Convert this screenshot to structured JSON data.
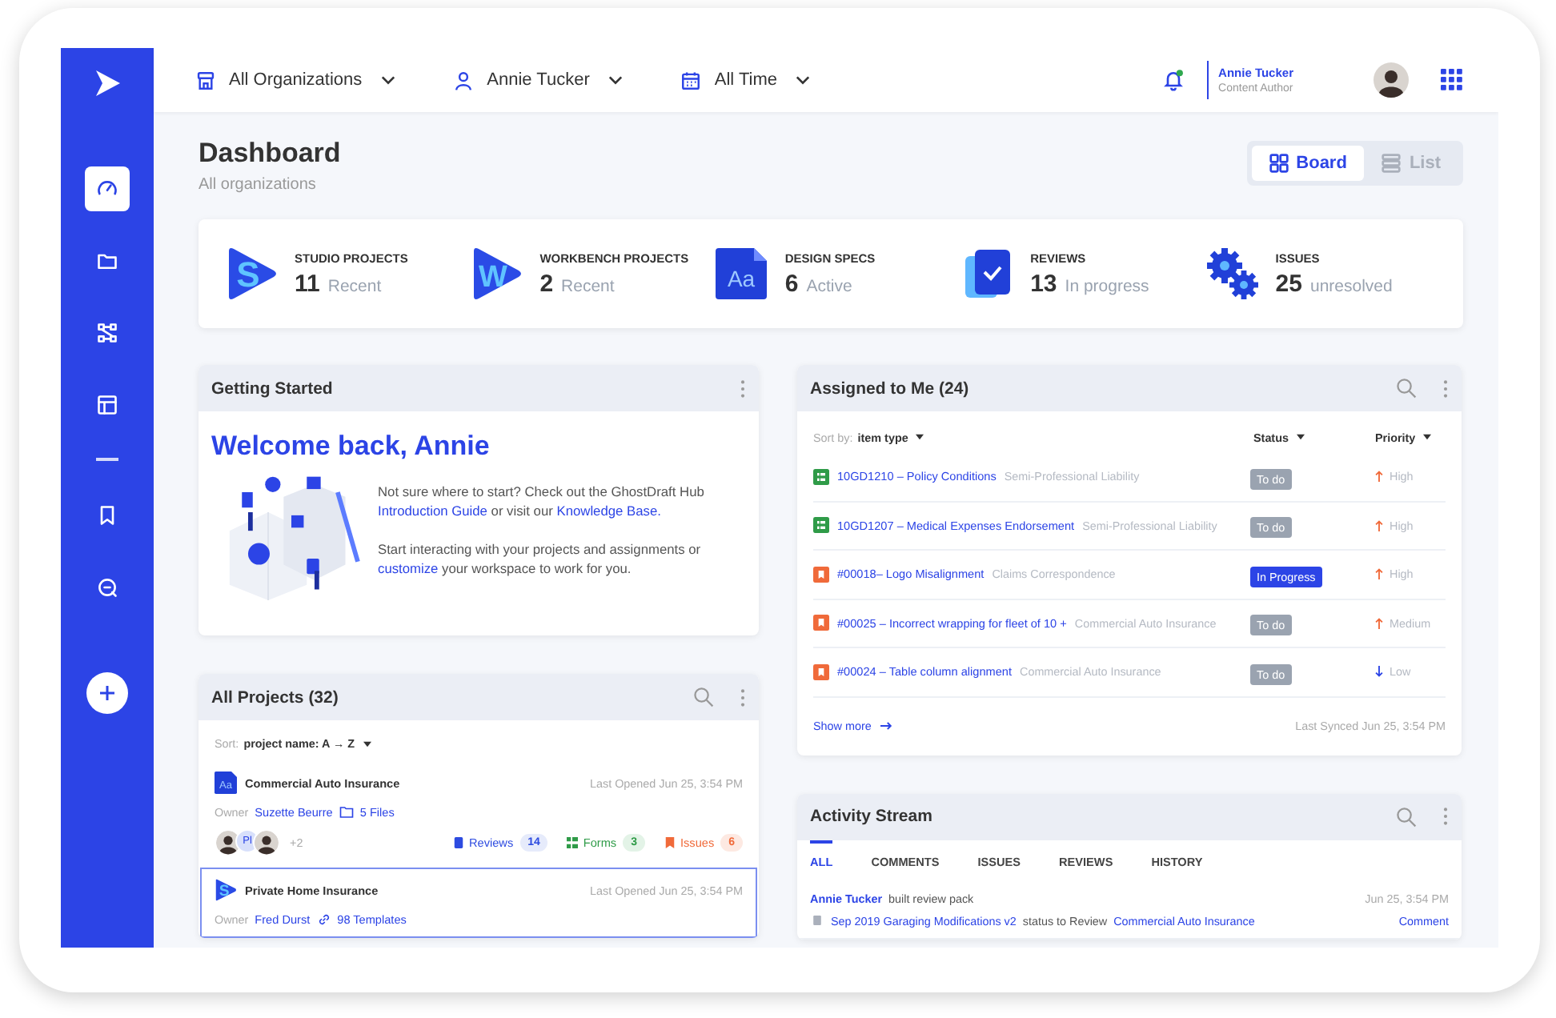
{
  "sidebar": {
    "sections": [
      {
        "items": [
          {
            "kind": "gauge",
            "selected": true
          },
          {
            "kind": "folder",
            "selected": false
          },
          {
            "kind": "nodes",
            "selected": false
          },
          {
            "kind": "layout",
            "selected": false
          }
        ]
      },
      {
        "items": [
          {
            "kind": "bookmark",
            "selected": false
          },
          {
            "kind": "search",
            "selected": false
          }
        ]
      }
    ],
    "action": {
      "kind": "add"
    }
  },
  "topbar": {
    "filters": [
      {
        "kind": "organization",
        "label": "All Organizations"
      },
      {
        "kind": "person",
        "label": "Annie Tucker"
      },
      {
        "kind": "calendar",
        "label": "All Time"
      }
    ],
    "notifications": {
      "unread": true
    },
    "user": {
      "name": "Annie Tucker",
      "role": "Content Author"
    }
  },
  "page": {
    "title": "Dashboard",
    "subtitle": "All organizations",
    "views": [
      {
        "kind": "board",
        "label": "Board",
        "selected": true
      },
      {
        "kind": "list",
        "label": "List",
        "selected": false
      }
    ]
  },
  "stats": [
    {
      "kind": "studio",
      "glyph": "S",
      "label": "STUDIO PROJECTS",
      "count": "11",
      "note": "Recent"
    },
    {
      "kind": "workbench",
      "glyph": "W",
      "label": "WORKBENCH PROJECTS",
      "count": "2",
      "note": "Recent"
    },
    {
      "kind": "design",
      "glyph": "Aa",
      "label": "DESIGN SPECS",
      "count": "6",
      "note": "Active"
    },
    {
      "kind": "reviews",
      "label": "REVIEWS",
      "count": "13",
      "note": "In progress"
    },
    {
      "kind": "issues",
      "label": "ISSUES",
      "count": "25",
      "note": "unresolved"
    }
  ],
  "getting_started": {
    "title": "Getting Started",
    "heading": "Welcome back, Annie",
    "paragraphs": [
      [
        {
          "text": "Not sure where to start? Check out the GhostDraft Hub "
        },
        {
          "text": "Introduction Guide",
          "link": true
        },
        {
          "text": " or visit our "
        },
        {
          "text": "Knowledge Base.",
          "link": true
        }
      ],
      [
        {
          "text": "Start interacting with your projects and assignments or "
        },
        {
          "text": "customize",
          "link": true
        },
        {
          "text": " your workspace to work for you."
        }
      ]
    ]
  },
  "projects": {
    "title": "All Projects (32)",
    "sort_label": "Sort:",
    "sort_value": "project name: A → Z",
    "items": [
      {
        "kind": "design",
        "glyph": "Aa",
        "name": "Commercial Auto Insurance",
        "opened": "Last Opened Jun 25, 3:54 PM",
        "owner_label": "Owner",
        "owner": "Suzette Beurre",
        "files": {
          "kind": "folder",
          "label": "5 Files"
        },
        "selected": false,
        "avatars": [
          {
            "kind": "photo"
          },
          {
            "kind": "initials",
            "text": "Pl"
          },
          {
            "kind": "photo"
          }
        ],
        "more": "+2",
        "counts": [
          {
            "kind": "reviews",
            "label": "Reviews",
            "value": "14"
          },
          {
            "kind": "forms",
            "label": "Forms",
            "value": "3"
          },
          {
            "kind": "issues",
            "label": "Issues",
            "value": "6"
          }
        ]
      },
      {
        "kind": "studio",
        "glyph": "S",
        "name": "Private Home Insurance",
        "opened": "Last Opened Jun 25, 3:54 PM",
        "owner_label": "Owner",
        "owner": "Fred Durst",
        "files": {
          "kind": "link",
          "label": "98 Templates"
        },
        "selected": true
      }
    ]
  },
  "assigned": {
    "title": "Assigned to Me (24)",
    "sort_label": "Sort by:",
    "sort_value": "item type",
    "columns": [
      "Status",
      "Priority"
    ],
    "rows": [
      {
        "kind": "form",
        "title": "10GD1210 – Policy Conditions",
        "project": "Semi-Professional Liability",
        "status": {
          "kind": "todo",
          "label": "To do"
        },
        "priority": {
          "kind": "up",
          "label": "High"
        }
      },
      {
        "kind": "form",
        "title": "10GD1207 – Medical Expenses Endorsement",
        "project": "Semi-Professional Liability",
        "status": {
          "kind": "todo",
          "label": "To do"
        },
        "priority": {
          "kind": "up",
          "label": "High"
        }
      },
      {
        "kind": "issue",
        "title": "#00018– Logo Misalignment",
        "project": "Claims Correspondence",
        "status": {
          "kind": "progress",
          "label": "In Progress"
        },
        "priority": {
          "kind": "up",
          "label": "High"
        }
      },
      {
        "kind": "issue",
        "title": "#00025 – Incorrect wrapping for fleet of 10 +",
        "project": "Commercial Auto Insurance",
        "status": {
          "kind": "todo",
          "label": "To do"
        },
        "priority": {
          "kind": "up",
          "label": "Medium"
        }
      },
      {
        "kind": "issue",
        "title": "#00024 – Table column alignment",
        "project": "Commercial Auto Insurance",
        "status": {
          "kind": "todo",
          "label": "To do"
        },
        "priority": {
          "kind": "down",
          "label": "Low"
        }
      }
    ],
    "show_more": "Show more",
    "synced": "Last Synced Jun 25, 3:54 PM"
  },
  "activity": {
    "title": "Activity Stream",
    "tabs": [
      {
        "label": "ALL",
        "selected": true
      },
      {
        "label": "COMMENTS",
        "selected": false
      },
      {
        "label": "ISSUES",
        "selected": false
      },
      {
        "label": "REVIEWS",
        "selected": false
      },
      {
        "label": "HISTORY",
        "selected": false
      }
    ],
    "entries": [
      {
        "user": "Annie Tucker",
        "action": "built review pack",
        "time": "Jun 25, 3:54 PM",
        "document": "Sep 2019 Garaging Modifications v2",
        "detail": "status to Review",
        "project": "Commercial Auto Insurance",
        "reply": "Comment"
      }
    ]
  }
}
